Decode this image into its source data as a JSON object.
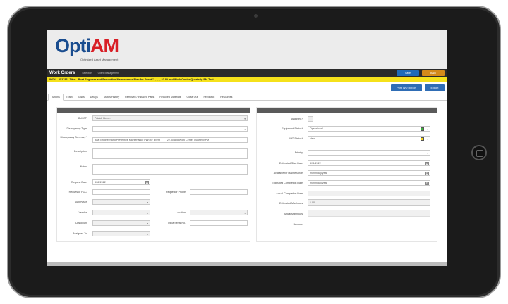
{
  "brand": {
    "logo_opti": "Opti",
    "logo_am": "AM",
    "tagline": "Optimized Asset Management"
  },
  "navbar": {
    "title": "Work Orders",
    "links": [
      "Selection",
      "Client Management"
    ],
    "save_label": "Save",
    "back_label": "Back"
  },
  "work_order": {
    "wo_label": "WO#:",
    "wo_number": "252786",
    "title_label": "Title:",
    "title": "Boat Engineer and Preventive Maintenance Plan for Event \" _ _ _ 22.80 and Work Center Quarterly PM Test"
  },
  "actions": {
    "print_label": "Print WO Report",
    "export_label": "Export"
  },
  "tabs": [
    "Actions",
    "Team",
    "Tasks",
    "Delays",
    "Status History",
    "Removed / Installed Parts",
    "Required Materials",
    "Close Out",
    "Feedback",
    "Resources"
  ],
  "left_form": {
    "bu_label": "BU/IOT",
    "bu_value": "Patrick Hoven",
    "discrepancy_type_label": "Discrepancy Type",
    "discrepancy_summary_label": "Discrepancy Summary*",
    "discrepancy_summary_value": "Boat Engineer and Preventive Maintenance Plan for Event   _ _ _ 22.80 and Work Center Quarterly PM",
    "description_label": "Description",
    "notes_label": "Notes",
    "request_date_label": "Request Date",
    "request_date_value": "4/11/2022",
    "requestor_poc_label": "Requestor POC",
    "requestor_phone_label": "Requestor Phone",
    "supervisor_label": "Supervisor",
    "vendor_label": "Vendor",
    "location_label": "Location",
    "custodian_label": "Custodian",
    "oem_serial_label": "OEM Serial No.",
    "assigned_to_label": "Assigned To"
  },
  "right_form": {
    "archived_label": "Archived?",
    "equipment_status_label": "Equipment Status*",
    "equipment_status_value": "Operational",
    "equipment_status_color": "#3db53d",
    "wo_status_label": "WO Status*",
    "wo_status_value": "New",
    "wo_status_color": "#f2d21b",
    "priority_label": "Priority",
    "est_start_label": "Estimated Start Date",
    "est_start_value": "4/11/2022",
    "available_label": "Available for Maintenance",
    "available_value": "month/day/year",
    "est_completion_label": "Estimated Completion Date",
    "est_completion_value": "month/day/year",
    "actual_completion_label": "Actual Completion Date",
    "est_manhours_label": "Estimated Manhours",
    "est_manhours_value": "1.00",
    "actual_manhours_label": "Actual Manhours",
    "barcode_label": "Barcode"
  }
}
